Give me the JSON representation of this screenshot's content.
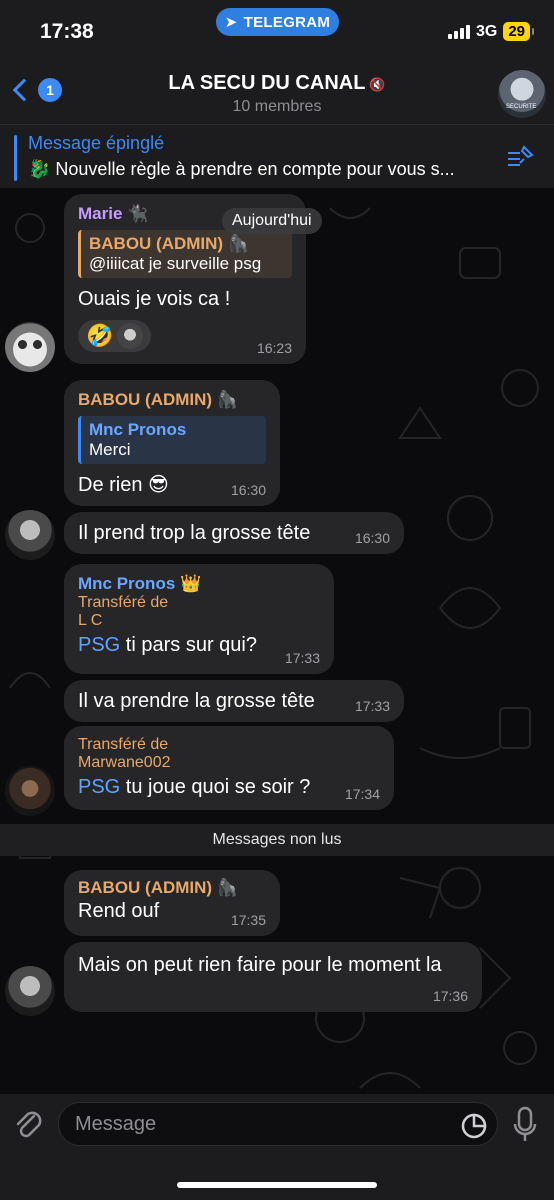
{
  "status_bar": {
    "time": "17:38",
    "app_pill": "TELEGRAM",
    "network": "3G",
    "battery": "29"
  },
  "header": {
    "back_badge": "1",
    "title": "LA SECU DU CANAL",
    "subtitle": "10 membres",
    "avatar_text": "SECURITE"
  },
  "pinned": {
    "label": "Message épinglé",
    "text": "🐉 Nouvelle règle à prendre en compte pour vous s..."
  },
  "chat": {
    "date_chip": "Aujourd'hui",
    "unread_label": "Messages non lus",
    "messages": [
      {
        "sender": "Marie 🐈‍⬛",
        "reply_name": "BABOU (ADMIN) 🦍",
        "reply_text": "@iiiicat je surveille psg",
        "text": "Ouais je vois ca !",
        "reaction_emoji": "🤣",
        "time": "16:23"
      },
      {
        "sender": "BABOU (ADMIN) 🦍",
        "reply_name": "Mnc Pronos",
        "reply_text": "Merci",
        "text": "De rien 😎",
        "time": "16:30"
      },
      {
        "text": "Il prend trop la grosse tête",
        "time": "16:30"
      },
      {
        "sender": "Mnc Pronos 👑",
        "forwarded_label": "Transféré de",
        "forwarded_from": "L C",
        "link": "PSG",
        "text": " ti pars sur qui?",
        "time": "17:33"
      },
      {
        "text": "Il va prendre la grosse tête",
        "time": "17:33"
      },
      {
        "forwarded_label": "Transféré de",
        "forwarded_from": "Marwane002",
        "link": "PSG",
        "text": " tu joue quoi se soir ?",
        "time": "17:34"
      },
      {
        "sender": "BABOU (ADMIN) 🦍",
        "text": "Rend ouf",
        "time": "17:35"
      },
      {
        "text": "Mais on peut rien faire pour le moment la",
        "time": "17:36"
      }
    ]
  },
  "composer": {
    "placeholder": "Message"
  },
  "colors": {
    "accent": "#3b8af5",
    "admin_name": "#e8a86a",
    "marie_name": "#c79cff",
    "mnc_name": "#6aa8ff",
    "forward_label": "#e8a86a"
  }
}
